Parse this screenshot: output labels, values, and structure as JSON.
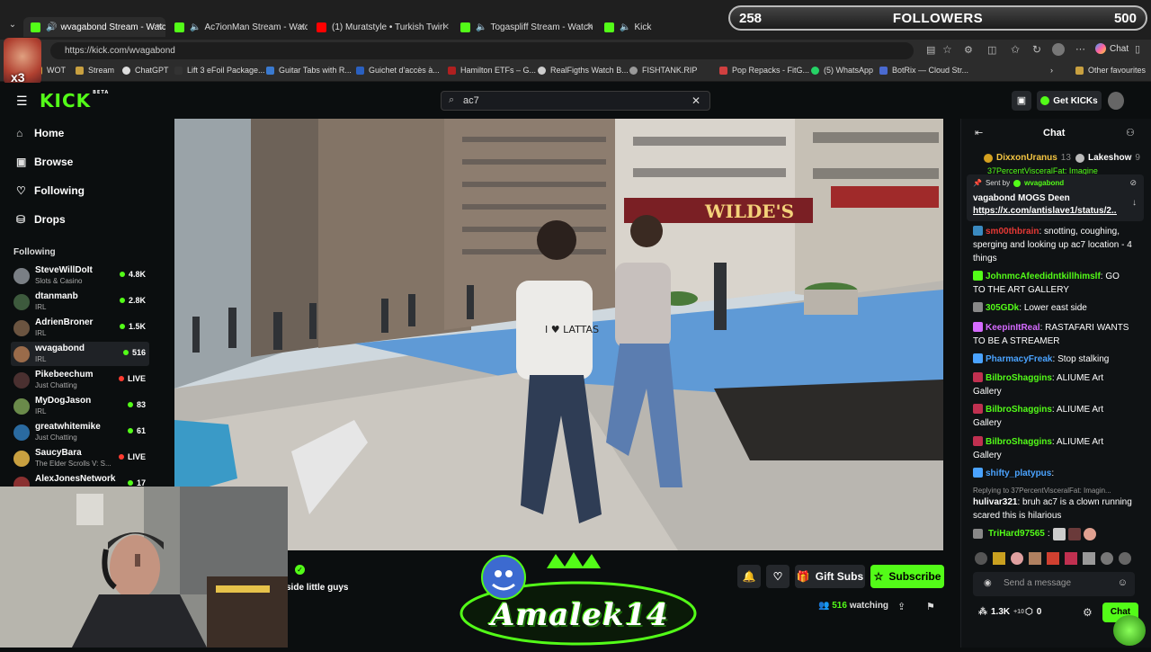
{
  "browser": {
    "tabs": [
      {
        "label": "wvagabond Stream - Watch L",
        "active": true
      },
      {
        "label": "Ac7ionMan Stream - Watch L"
      },
      {
        "label": "(1) Muratstyle • Turkish Twirl"
      },
      {
        "label": "Togaspliff Stream - Watch Live"
      },
      {
        "label": "Kick"
      }
    ],
    "url": "https://kick.com/wvagabond",
    "chat_button": "Chat",
    "bookmarks": [
      "WOT",
      "Stream",
      "ChatGPT",
      "Lift 3 eFoil Package...",
      "Guitar Tabs with R...",
      "Guichet d'accès à...",
      "Hamilton ETFs – G...",
      "RealFigths Watch B...",
      "FISHTANK.RIP",
      "Pop Repacks - FitG...",
      "(5) WhatsApp",
      "BotRix — Cloud Str..."
    ],
    "other_favourites": "Other favourites"
  },
  "overlay": {
    "followers_left": "258",
    "followers_label": "FOLLOWERS",
    "followers_right": "500",
    "brand_text": "Amalek14",
    "x13": "x3"
  },
  "kick": {
    "logo": "KICK",
    "beta": "BETA",
    "search_value": "ac7",
    "get_kicks": "Get KICKs"
  },
  "sidebar": {
    "nav": [
      {
        "label": "Home",
        "icon": "home-icon"
      },
      {
        "label": "Browse",
        "icon": "browse-icon"
      },
      {
        "label": "Following",
        "icon": "heart-icon"
      },
      {
        "label": "Drops",
        "icon": "drops-icon"
      }
    ],
    "following_header": "Following",
    "following": [
      {
        "name": "SteveWillDoIt",
        "category": "Slots & Casino",
        "viewers": "4.8K",
        "color": "#7a7f85"
      },
      {
        "name": "dtanmanb",
        "category": "IRL",
        "viewers": "2.8K",
        "color": "#3d5a3d"
      },
      {
        "name": "AdrienBroner",
        "category": "IRL",
        "viewers": "1.5K",
        "color": "#6b5440"
      },
      {
        "name": "wvagabond",
        "category": "IRL",
        "viewers": "516",
        "color": "#9a6b4a",
        "selected": true
      },
      {
        "name": "Pikebeechum",
        "category": "Just Chatting",
        "viewers": "LIVE",
        "color": "#4a3030",
        "live": true
      },
      {
        "name": "MyDogJason",
        "category": "IRL",
        "viewers": "83",
        "color": "#6a8a4a"
      },
      {
        "name": "greatwhitemike",
        "category": "Just Chatting",
        "viewers": "61",
        "color": "#2a6aa0"
      },
      {
        "name": "SaucyBara",
        "category": "The Elder Scrolls V: S...",
        "viewers": "LIVE",
        "color": "#c9a040",
        "live": true
      },
      {
        "name": "AlexJonesNetwork",
        "category": "",
        "viewers": "17",
        "color": "#8a3030"
      }
    ]
  },
  "stream": {
    "title_fragment": "side little guys",
    "gift_subs": "Gift Subs",
    "subscribe": "Subscribe",
    "watching_count": "516",
    "watching_label": "watching",
    "shirt_text": "I ♥ LATTAS"
  },
  "chat": {
    "title": "Chat",
    "top_gifters": [
      {
        "name": "DixxonUranus",
        "count": "13"
      },
      {
        "name": "Lakeshow",
        "count": "9"
      }
    ],
    "pinned": {
      "sent_by_label": "Sent by",
      "sent_by": "wvagabond",
      "text": "vagabond MOGS Deen",
      "link": "https://x.com/antislave1/status/2..."
    },
    "partial_line": "37PercentVisceralFat: Imagine",
    "messages": [
      {
        "user": "sm00thbrain",
        "color": "#e53935",
        "text": "snotting, coughing, sperging and looking up ac7 location - 4 things"
      },
      {
        "user": "JohnmcAfeedidntkillhimslf",
        "color": "#53fc18",
        "text": "GO TO THE ART GALLERY"
      },
      {
        "user": "305GDk",
        "color": "#53fc18",
        "text": "Lower east side"
      },
      {
        "user": "KeepinItReal",
        "color": "#d56bff",
        "text": "RASTAFARI WANTS TO BE A STREAMER"
      },
      {
        "user": "PharmacyFreak",
        "color": "#4aa3ff",
        "text": "Stop stalking"
      },
      {
        "user": "BilbroShaggins",
        "color": "#53fc18",
        "text": "ALIUME Art Gallery"
      },
      {
        "user": "BilbroShaggins",
        "color": "#53fc18",
        "text": "ALIUME Art Gallery"
      },
      {
        "user": "BilbroShaggins",
        "color": "#53fc18",
        "text": "ALIUME Art Gallery"
      },
      {
        "user": "shifty_platypus",
        "color": "#4aa3ff",
        "text": ""
      }
    ],
    "reply_context": "Replying to 37PercentVisceralFat: Imagin...",
    "reply": {
      "user": "hulivar321",
      "color": "#ffffff",
      "text": "bruh ac7 is a clown running scared this is hilarious"
    },
    "last_user": "TriHard97565",
    "last_user_color": "#53fc18",
    "input_placeholder": "Send a message",
    "kick_count": "1.3K",
    "kick_sup": "+10",
    "zero": "0",
    "chat_btn": "Chat"
  }
}
